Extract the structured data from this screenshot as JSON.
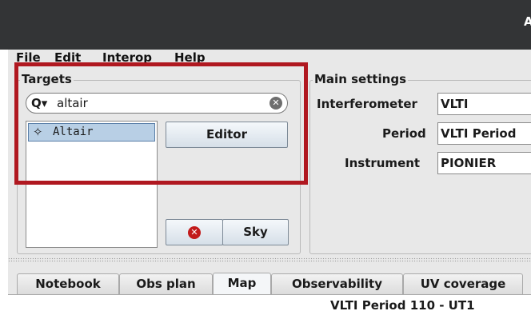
{
  "window": {
    "title": "A"
  },
  "menu": [
    "File",
    "Edit",
    "Interop",
    "Help"
  ],
  "targets": {
    "legend": "Targets",
    "search_value": "altair",
    "search_icon": "search-icon",
    "items": [
      "Altair"
    ],
    "editor_label": "Editor",
    "sky_label": "Sky"
  },
  "main_settings": {
    "legend": "Main settings",
    "interferometer_label": "Interferometer",
    "interferometer_value": "VLTI",
    "period_label": "Period",
    "period_value": "VLTI Period",
    "instrument_label": "Instrument",
    "instrument_value": "PIONIER"
  },
  "tabs": [
    "Notebook",
    "Obs plan",
    "Map",
    "Observability",
    "UV coverage"
  ],
  "active_tab": "Map",
  "map_caption": "VLTI Period 110 - UT1",
  "colors": {
    "highlight": "#b01820",
    "titlebar": "#333436",
    "selection": "#b8cfe5"
  }
}
